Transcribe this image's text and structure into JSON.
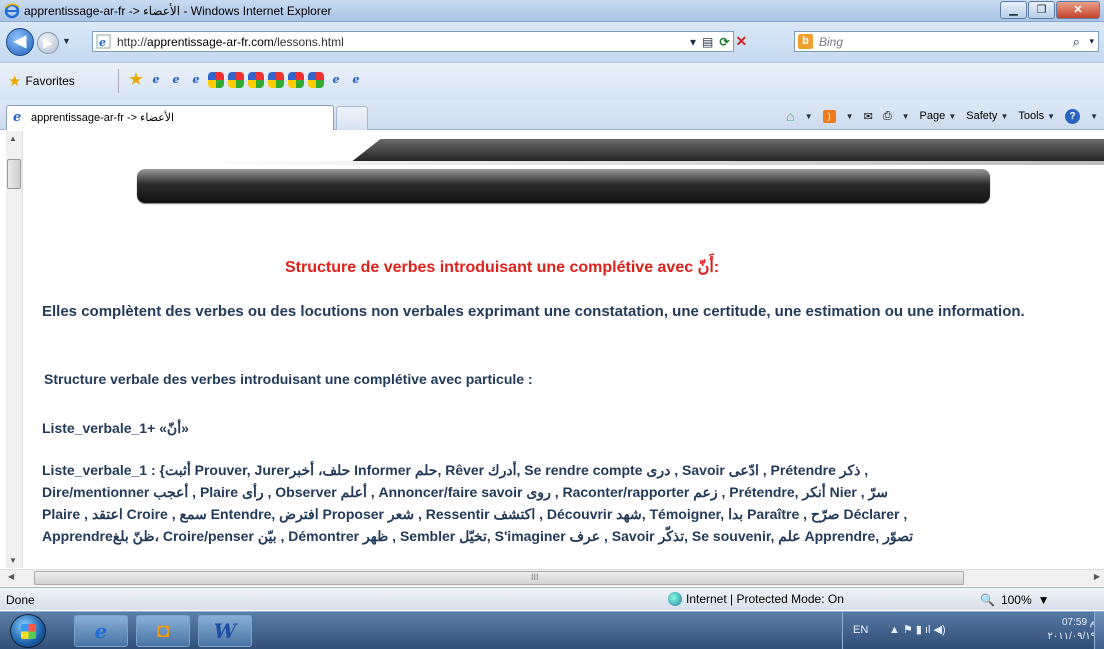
{
  "window": {
    "title": "apprentissage-ar-fr -> الأعضاء - Windows Internet Explorer",
    "min_glyph": "▁",
    "max_glyph": "❐",
    "close_glyph": "✕"
  },
  "nav": {
    "back_glyph": "◀",
    "forward_glyph": "▶",
    "recent_glyph": "▼",
    "url_prefix": "http://",
    "url_host": "apprentissage-ar-fr.com",
    "url_path": "/lessons.html",
    "search_placeholder": "Bing",
    "search_logo": "b",
    "search_glyph": "⌕",
    "refresh_glyph": "⟳",
    "stop_glyph": "✕",
    "compat_glyph": "▤",
    "dropdown_glyph": "▾"
  },
  "favorites": {
    "label": "Favorites",
    "star_glyph": "★",
    "addfav_glyph": "★",
    "ie_glyph": "e",
    "items": [
      "addfav",
      "ie",
      "ie",
      "ie",
      "gs",
      "gs",
      "gs",
      "gs",
      "gs",
      "gs",
      "ie",
      "ie"
    ]
  },
  "tabs": {
    "active_label": "apprentissage-ar-fr -> الأعضاء",
    "icon_glyph": "e"
  },
  "commandbar": {
    "home_glyph": "⌂",
    "caret_glyph": "▼",
    "rss_glyph": ")",
    "mail_glyph": "✉",
    "print_glyph": "⎙",
    "page_label": "Page",
    "safety_label": "Safety",
    "tools_label": "Tools",
    "help_glyph": "?"
  },
  "content": {
    "heading": "Structure de verbes introduisant une complétive avec  أَنّ:",
    "para1": "Elles complètent des verbes ou des locutions non verbales exprimant une constatation, une certitude, une estimation ou une information.",
    "para2": "Structure verbale des verbes introduisant une complétive avec particule :",
    "para3": "Liste_verbale_1+ «أنّ»",
    "list_lines": [
      "Liste_verbale_1 : {أثبت Prouver, Jurerحلف، أخبر Informer حلم, Rêver أدرك, Se rendre compte  درى , Savoir ادّعى , Prétendre ذكر ,",
      "Dire/mentionner أعجب , Plaire  رأى , Observer أعلم , Annoncer/faire savoir روى , Raconter/rapporter زعم , Prétendre, أنكر Nier , سرّ",
      "Plaire , اعتقد Croire , سمع Entendre, افترض Proposer شعر , Ressentir اكتشف , Découvrir شهد, Témoigner, بدا Paraître , صرّح Déclarer ,",
      "Apprendreظنّ بلغ، Croire/penser بيّن , Démontrer ظهر , Sembler تخيّل, S'imaginer عرف , Savoir تذكّر, Se souvenir, علم Apprendre, تصوّر"
    ],
    "grip_glyph": "III",
    "up_glyph": "▲",
    "down_glyph": "▼",
    "left_glyph": "◀",
    "right_glyph": "▶"
  },
  "status": {
    "left": "Done",
    "zone": "Internet | Protected Mode: On",
    "zoom": "100%",
    "zoom_glyph": "🔍",
    "caret_glyph": "▼"
  },
  "taskbar": {
    "ie_glyph": "e",
    "media_glyph": "◘",
    "word_glyph": "W",
    "lang": "EN",
    "tray_glyphs": "▲  ⚑  ▮  ıl  ◀)",
    "time": "م 07:59",
    "date": "٢٠١١/٠٩/١٩"
  },
  "colors": {
    "heading": "#e0201a",
    "body_text": "#233b5b",
    "chrome": "#c6d9f0"
  }
}
